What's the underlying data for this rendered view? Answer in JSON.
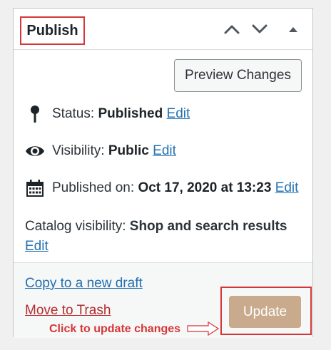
{
  "panel": {
    "title": "Publish",
    "header_buttons": {
      "move_up": "chevron-up-icon",
      "move_down": "chevron-down-icon",
      "toggle": "triangle-up-icon"
    }
  },
  "actions": {
    "preview_label": "Preview Changes"
  },
  "status": {
    "label": "Status:",
    "value": "Published",
    "edit": "Edit",
    "icon": "pin-icon"
  },
  "visibility": {
    "label": "Visibility:",
    "value": "Public",
    "edit": "Edit",
    "icon": "eye-icon"
  },
  "published_on": {
    "label": "Published on:",
    "value": "Oct 17, 2020 at 13:23",
    "edit": "Edit",
    "icon": "calendar-icon"
  },
  "catalog": {
    "label": "Catalog visibility:",
    "value": "Shop and search results",
    "edit": "Edit"
  },
  "footer": {
    "copy_draft": "Copy to a new draft",
    "trash": "Move to Trash",
    "update_label": "Update",
    "annotation": "Click to update changes"
  },
  "colors": {
    "link": "#2271b1",
    "trash": "#b32d2e",
    "annotation_red": "#d63638",
    "update_button": "#c9aa8d"
  }
}
